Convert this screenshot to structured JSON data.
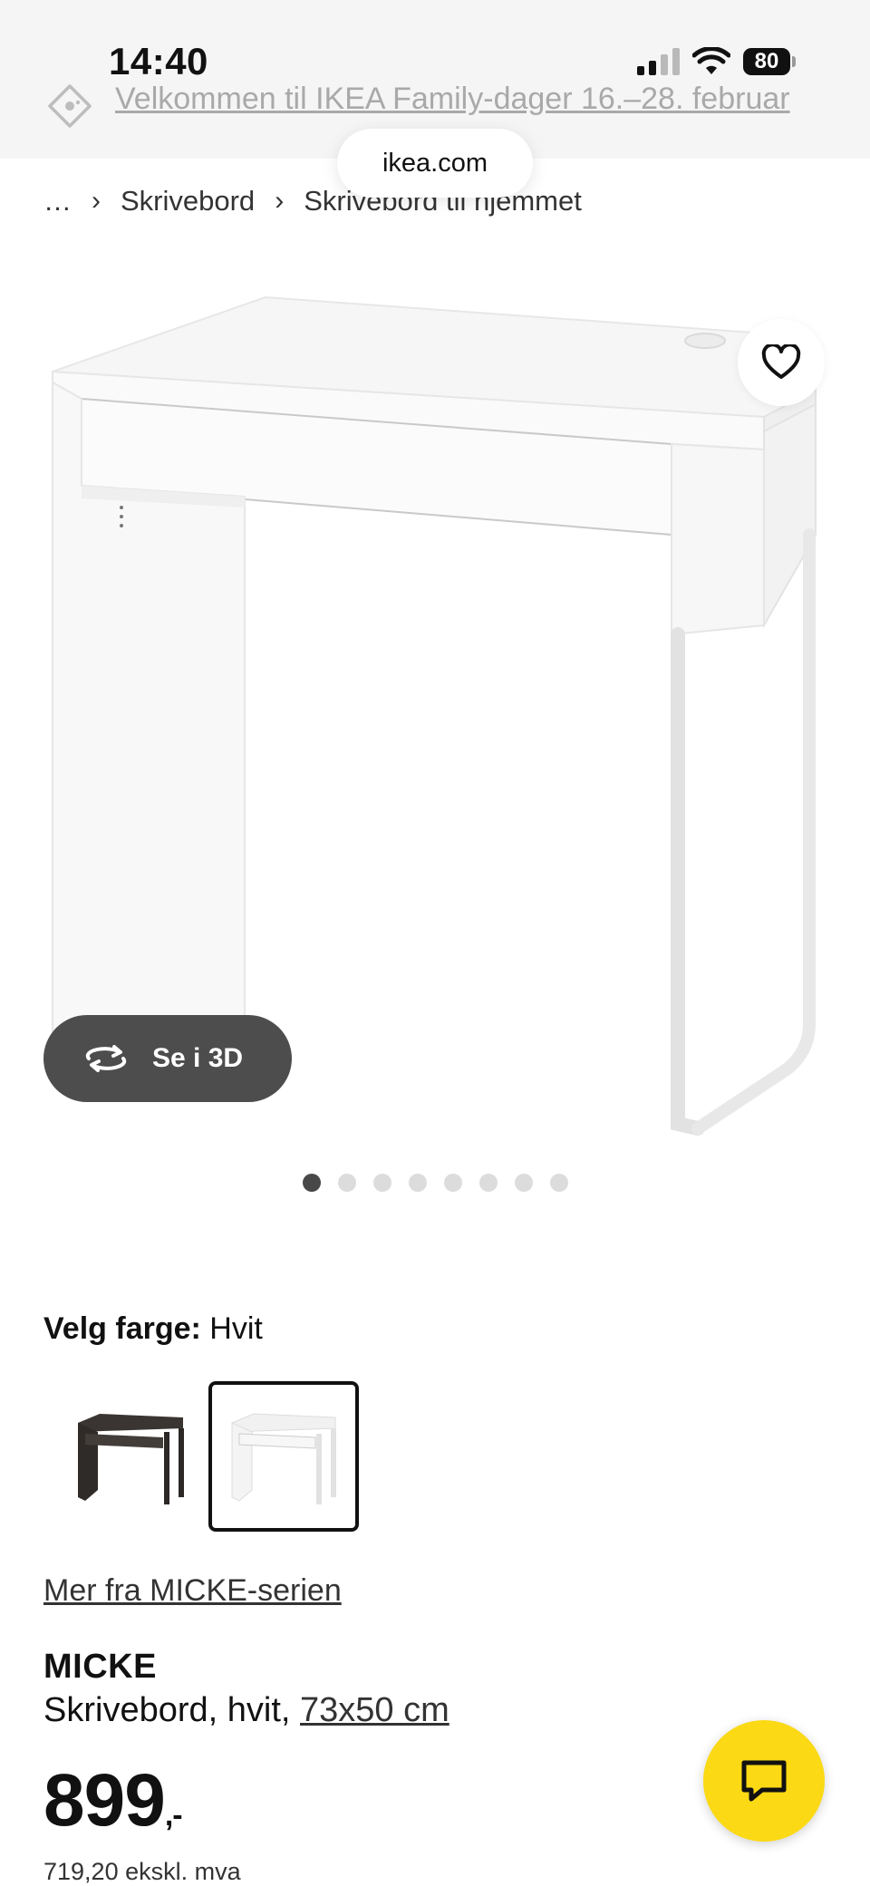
{
  "status_bar": {
    "time": "14:40",
    "battery": "80"
  },
  "promo": {
    "text": "Velkommen til IKEA Family-dager 16.–28. februar"
  },
  "browser": {
    "url": "ikea.com"
  },
  "breadcrumb": {
    "items": [
      "…",
      "Skrivebord",
      "Skrivebord til hjemmet"
    ]
  },
  "gallery": {
    "view_3d_label": "Se i 3D",
    "image_count": 8,
    "active_index": 0
  },
  "color": {
    "label": "Velg farge:",
    "value": "Hvit",
    "options": [
      "Svartbrun",
      "Hvit"
    ],
    "selected": "Hvit"
  },
  "series_link": "Mer fra MICKE-serien",
  "product": {
    "name": "MICKE",
    "desc_prefix": "Skrivebord, hvit,",
    "size": "73x50 cm",
    "price": "899",
    "price_suffix": ",-",
    "price_excl_vat": "719,20 ekskl. mva"
  },
  "colors": {
    "chat_button": "#fbd914",
    "three_d_button": "#4d4d4d"
  }
}
